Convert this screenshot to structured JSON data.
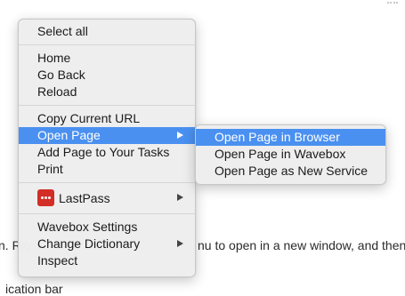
{
  "background": {
    "line_left": "n. Rig",
    "line_right": "nu to open in a new window, and then us",
    "line_bottom": "ication bar"
  },
  "context_menu": {
    "select_all": "Select all",
    "home": "Home",
    "go_back": "Go Back",
    "reload": "Reload",
    "copy_current_url": "Copy Current URL",
    "open_page": "Open Page",
    "add_page_to_tasks": "Add Page to Your Tasks",
    "print": "Print",
    "lastpass": "LastPass",
    "wavebox_settings": "Wavebox Settings",
    "change_dictionary": "Change Dictionary",
    "inspect": "Inspect"
  },
  "submenu": {
    "open_in_browser": "Open Page in Browser",
    "open_in_wavebox": "Open Page in Wavebox",
    "open_as_new_service": "Open Page as New Service"
  },
  "colors": {
    "highlight": "#4a90f0",
    "lastpass_red": "#d32d27",
    "menu_bg": "#eeeeee"
  }
}
